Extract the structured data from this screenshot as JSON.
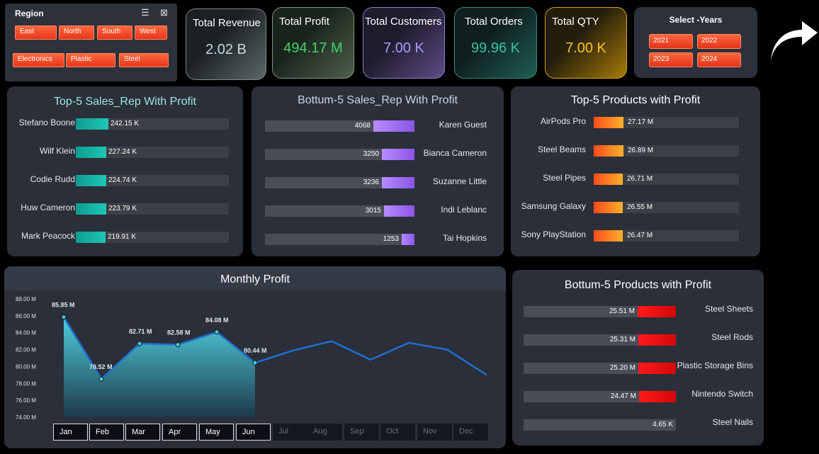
{
  "region": {
    "title": "Region",
    "items": [
      "East",
      "North",
      "South",
      "West",
      "Electronics",
      "Plastic",
      "Steel"
    ]
  },
  "kpis": [
    {
      "label": "Total Revenue",
      "value": "2.02 B",
      "color": "#c8d7df"
    },
    {
      "label": "Total Profit",
      "value": "494.17 M",
      "color": "#3fd46b"
    },
    {
      "label": "Total Customers",
      "value": "7.00 K",
      "color": "#a99bff"
    },
    {
      "label": "Total Orders",
      "value": "99.96 K",
      "color": "#37c2a6"
    },
    {
      "label": "Total QTY",
      "value": "7.00 K",
      "color": "#ffc11a"
    }
  ],
  "years": {
    "title": "Select -Years",
    "items": [
      "2021",
      "2022",
      "2023",
      "2024"
    ]
  },
  "top_sales_rep": {
    "title": "Top-5 Sales_Rep With Profit",
    "rows": [
      {
        "name": "Stefano Boone",
        "value": "242.15 K",
        "frac": 1.0
      },
      {
        "name": "Wilf Klein",
        "value": "227.24 K",
        "frac": 0.938
      },
      {
        "name": "Codie Rudd",
        "value": "224.74 K",
        "frac": 0.928
      },
      {
        "name": "Huw Cameron",
        "value": "223.79 K",
        "frac": 0.924
      },
      {
        "name": "Mark Peacock",
        "value": "219.91 K",
        "frac": 0.908
      }
    ]
  },
  "bottom_sales_rep": {
    "title": "Bottum-5 Sales_Rep With Profit",
    "rows": [
      {
        "name": "Karen Guest",
        "value": "4068",
        "frac": 1.0
      },
      {
        "name": "Bianca Cameron",
        "value": "3250",
        "frac": 0.8
      },
      {
        "name": "Suzanne Little",
        "value": "3236",
        "frac": 0.795
      },
      {
        "name": "Indi Leblanc",
        "value": "3015",
        "frac": 0.74
      },
      {
        "name": "Tai Hopkins",
        "value": "1253",
        "frac": 0.308
      }
    ]
  },
  "top_products": {
    "title": "Top-5 Products with Profit",
    "rows": [
      {
        "name": "AirPods Pro",
        "value": "27.17 M",
        "frac": 1.0
      },
      {
        "name": "Steel Beams",
        "value": "26.89 M",
        "frac": 0.99
      },
      {
        "name": "Steel Pipes",
        "value": "26.71 M",
        "frac": 0.983
      },
      {
        "name": "Samsung Galaxy",
        "value": "26.55 M",
        "frac": 0.977
      },
      {
        "name": "Sony PlayStation",
        "value": "26.47 M",
        "frac": 0.974
      }
    ]
  },
  "bottom_products": {
    "title": "Bottum-5 Products with Profit",
    "rows": [
      {
        "name": "Steel Sheets",
        "value": "25.51 M",
        "frac": 1.0
      },
      {
        "name": "Steel Rods",
        "value": "25.31 M",
        "frac": 0.99
      },
      {
        "name": "Plastic Storage Bins",
        "value": "25.20 M",
        "frac": 0.985
      },
      {
        "name": "Nintendo Switch",
        "value": "24.47 M",
        "frac": 0.96
      },
      {
        "name": "Steel Nails",
        "value": "4.65 K",
        "frac": 0.0
      }
    ]
  },
  "monthly": {
    "title": "Monthly Profit",
    "months": [
      "Jan",
      "Feb",
      "Mar",
      "Apr",
      "May",
      "Jun",
      "Jul",
      "Aug",
      "Sep",
      "Oct",
      "Nov",
      "Dec"
    ],
    "selected_count": 6
  },
  "chart_data": {
    "type": "area",
    "title": "Monthly Profit",
    "categories": [
      "Jan",
      "Feb",
      "Mar",
      "Apr",
      "May",
      "Jun",
      "Jul",
      "Aug",
      "Sep",
      "Oct",
      "Nov",
      "Dec"
    ],
    "series": [
      {
        "values": [
          85.85,
          78.52,
          82.71,
          82.58,
          84.08,
          80.44,
          81.9,
          83.0,
          80.8,
          82.8,
          82.0,
          79.0
        ]
      }
    ],
    "labels": [
      "85.85 M",
      "78.52 M",
      "82.71 M",
      "82.58 M",
      "84.08 M",
      "80.44 M"
    ],
    "yticks": [
      "74.00 M",
      "76.00 M",
      "78.00 M",
      "80.00 M",
      "82.00 M",
      "84.00 M",
      "86.00 M",
      "88.00 M"
    ],
    "ylim": [
      74,
      88
    ],
    "grid": false
  },
  "colors": {
    "accent_teal": "#14b3a4",
    "accent_purple": "#a06bf0",
    "accent_orange": "#ff7a1a",
    "accent_red": "#e60c0c",
    "line": "#1f6fd0"
  }
}
